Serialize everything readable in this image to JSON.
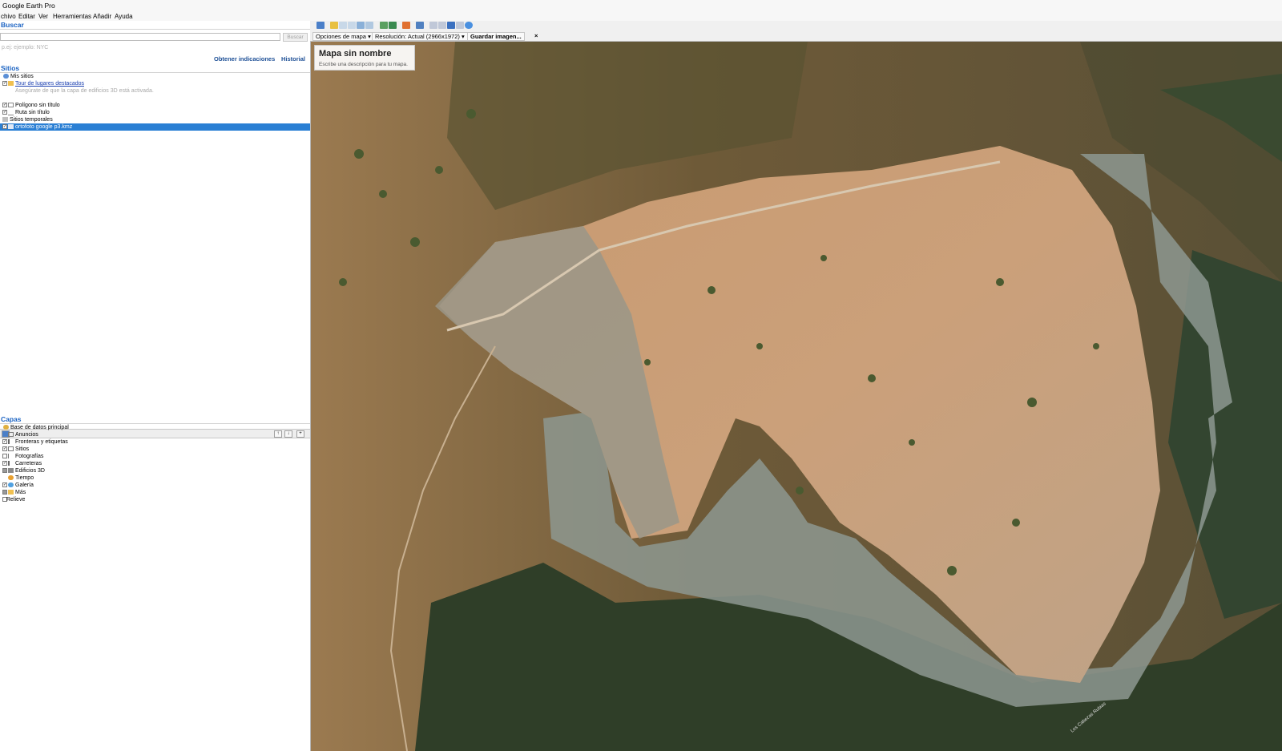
{
  "window": {
    "title": "Google Earth Pro"
  },
  "menu": [
    "chivo",
    "Editar",
    "Ver",
    "Herramientas",
    "Añadir",
    "Ayuda"
  ],
  "search": {
    "title": "Buscar",
    "placeholder": "",
    "button": "Buscar",
    "hint": "p.ej: ejemplo: NYC",
    "directions_link": "Obtener indicaciones",
    "history_link": "Historial"
  },
  "places": {
    "title": "Sitios",
    "items": [
      {
        "label": "Mis sitios"
      },
      {
        "label": "Tour de lugares destacados"
      },
      {
        "label": "Asegúrate de que la capa de edificios 3D está activada."
      },
      {
        "label": "Polígono sin título"
      },
      {
        "label": "Ruta sin título"
      },
      {
        "label": "Sitios temporales"
      },
      {
        "label": "ortofoto google p3.kmz"
      }
    ]
  },
  "layers": {
    "title": "Capas",
    "items": [
      {
        "label": "Base de datos principal"
      },
      {
        "label": "Anuncios"
      },
      {
        "label": "Fronteras y etiquetas"
      },
      {
        "label": "Sitios"
      },
      {
        "label": "Fotografías"
      },
      {
        "label": "Carreteras"
      },
      {
        "label": "Edificios 3D"
      },
      {
        "label": "Tiempo"
      },
      {
        "label": "Galería"
      },
      {
        "label": "Más"
      },
      {
        "label": "Relieve"
      }
    ]
  },
  "map_options": {
    "map_options_label": "Opciones de mapa",
    "resolution_label": "Resolución: Actual (2966x1972)",
    "save_image_label": "Guardar imagen...",
    "close_label": "×"
  },
  "map_info": {
    "title": "Mapa sin nombre",
    "description": "Escribe una descripción para tu mapa."
  },
  "map_labels": {
    "road": "Los Cabezas Rubias"
  }
}
